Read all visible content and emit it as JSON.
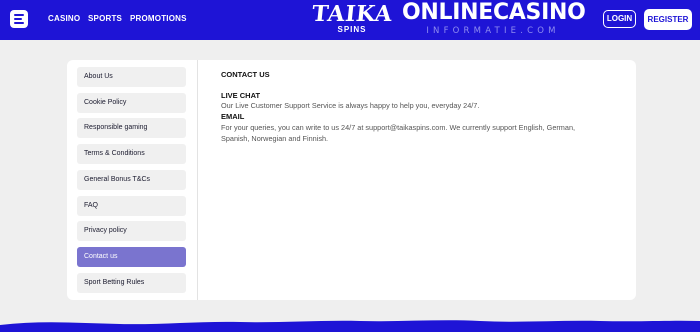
{
  "header": {
    "nav": [
      "CASINO",
      "SPORTS",
      "PROMOTIONS"
    ],
    "brand_logo": {
      "main": "TAIKA",
      "sub": "SPINS"
    },
    "partner_logo": {
      "main": "ONLINECASINO",
      "sub": "INFORMATIE.COM"
    },
    "login_label": "LOGIN",
    "register_label": "REGISTER"
  },
  "sidebar": {
    "items": [
      {
        "label": "About Us",
        "active": false
      },
      {
        "label": "Cookie Policy",
        "active": false
      },
      {
        "label": "Responsible gaming",
        "active": false
      },
      {
        "label": "Terms & Conditions",
        "active": false
      },
      {
        "label": "General Bonus T&Cs",
        "active": false
      },
      {
        "label": "FAQ",
        "active": false
      },
      {
        "label": "Privacy policy",
        "active": false
      },
      {
        "label": "Contact us",
        "active": true
      },
      {
        "label": "Sport Betting Rules",
        "active": false
      }
    ]
  },
  "content": {
    "title": "CONTACT US",
    "sections": [
      {
        "heading": "LIVE CHAT",
        "text": "Our Live Customer Support Service is always happy to help you, everyday 24/7."
      },
      {
        "heading": "EMAIL",
        "text": "For your queries, you can write to us 24/7 at support@taikaspins.com. We currently support English, German, Spanish, Norwegian and Finnish."
      }
    ]
  },
  "colors": {
    "brand": "#1e14d6",
    "active_item": "#7a74cf",
    "background": "#efefef"
  },
  "icons": {
    "menu": "menu-icon"
  }
}
